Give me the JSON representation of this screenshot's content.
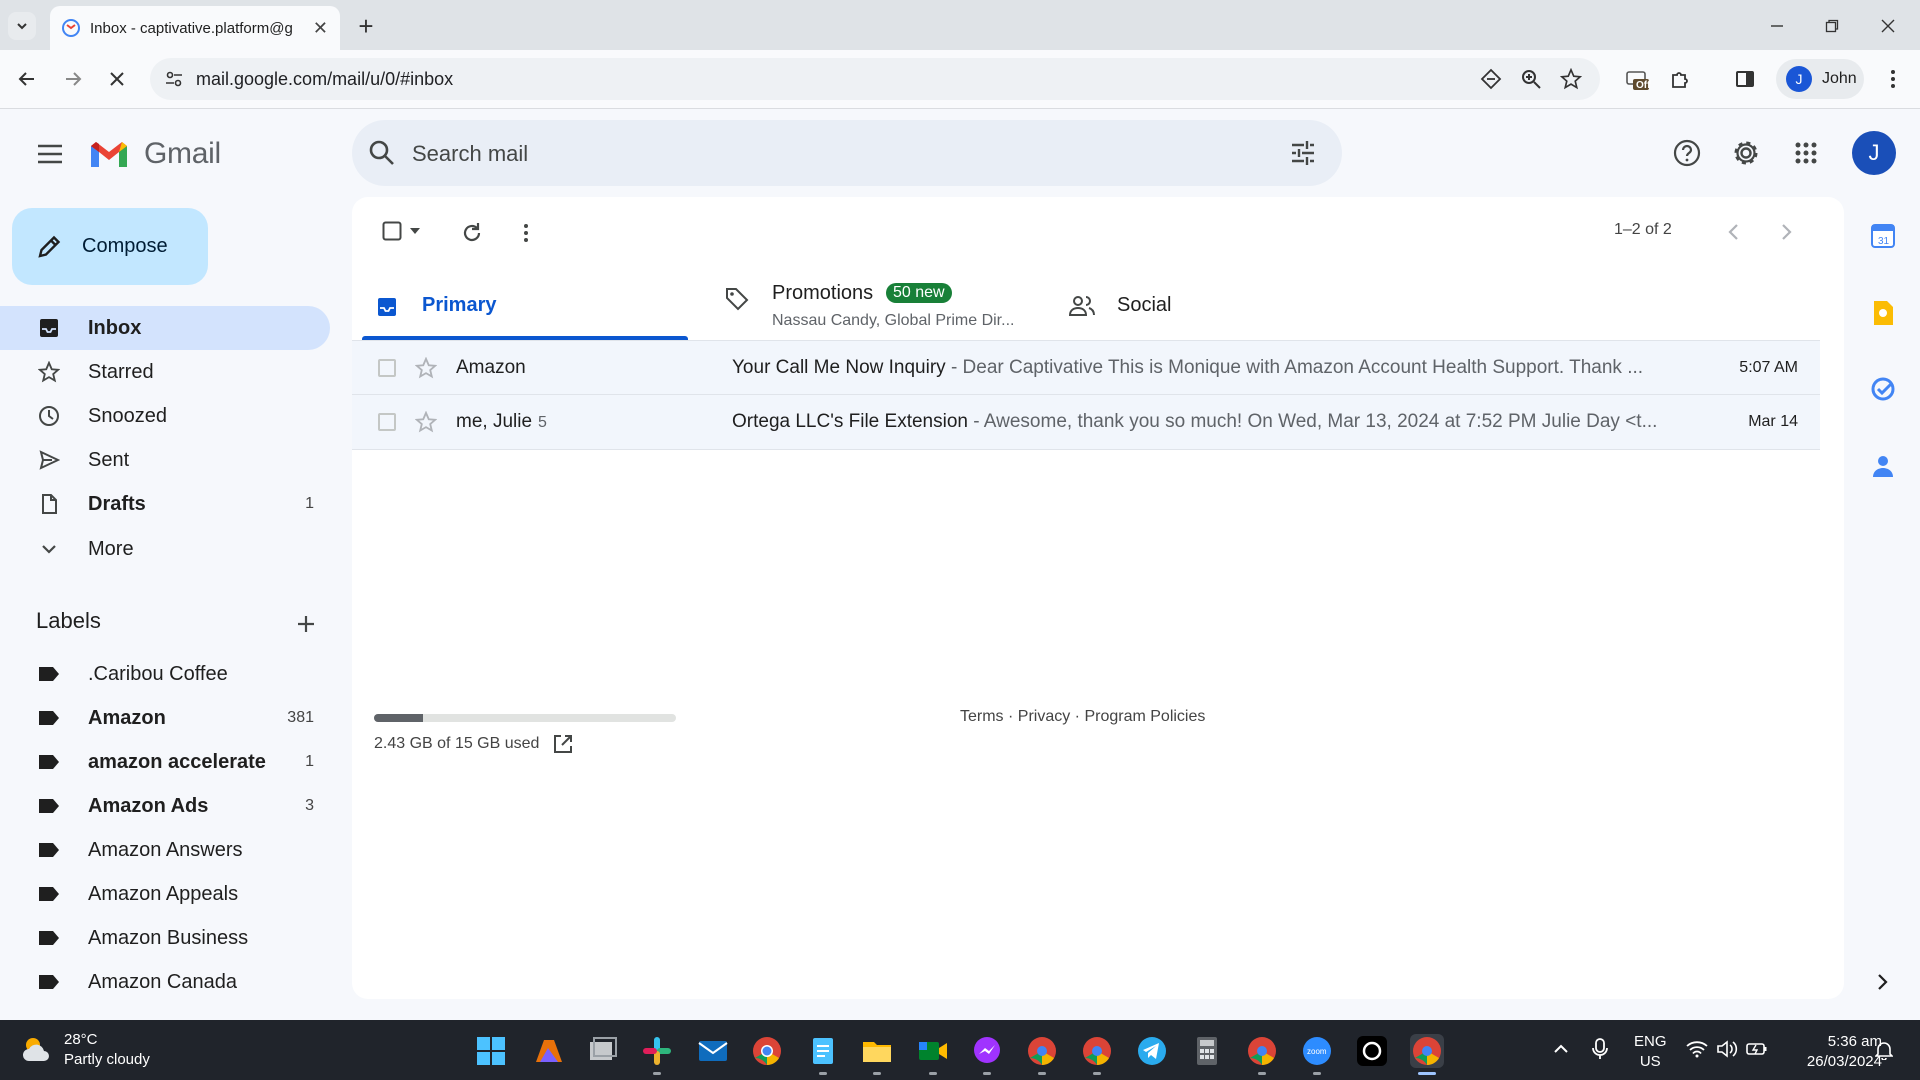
{
  "browser": {
    "tab_title": "Inbox - captivative.platform@g",
    "url": "mail.google.com/mail/u/0/#inbox",
    "profile_initial": "J",
    "profile_name": "John",
    "extension_badge": "Off"
  },
  "header": {
    "app_name": "Gmail",
    "search_placeholder": "Search mail",
    "account_initial": "J"
  },
  "compose": {
    "label": "Compose"
  },
  "nav": [
    {
      "label": "Inbox",
      "count": "",
      "icon": "inbox-icon"
    },
    {
      "label": "Starred",
      "count": "",
      "icon": "star-icon"
    },
    {
      "label": "Snoozed",
      "count": "",
      "icon": "clock-icon"
    },
    {
      "label": "Sent",
      "count": "",
      "icon": "send-icon"
    },
    {
      "label": "Drafts",
      "count": "1",
      "icon": "draft-icon"
    },
    {
      "label": "More",
      "count": "",
      "icon": "chevron-down-icon"
    }
  ],
  "labels": {
    "heading": "Labels",
    "items": [
      {
        "label": ".Caribou Coffee",
        "count": ""
      },
      {
        "label": "Amazon",
        "count": "381"
      },
      {
        "label": "amazon accelerate",
        "count": "1"
      },
      {
        "label": "Amazon Ads",
        "count": "3"
      },
      {
        "label": "Amazon Answers",
        "count": ""
      },
      {
        "label": "Amazon Appeals",
        "count": ""
      },
      {
        "label": "Amazon Business",
        "count": ""
      },
      {
        "label": "Amazon Canada",
        "count": ""
      }
    ]
  },
  "toolbar": {
    "pager": "1–2 of 2"
  },
  "tabs": {
    "primary": "Primary",
    "promotions": "Promotions",
    "promotions_badge": "50 new",
    "promotions_sub": "Nassau Candy, Global Prime Dir...",
    "social": "Social"
  },
  "emails": [
    {
      "sender": "Amazon",
      "count": "",
      "subject": "Your Call Me Now Inquiry",
      "snippet": " - Dear Captivative This is Monique with Amazon Account Health Support. Thank ...",
      "date": "5:07 AM"
    },
    {
      "sender": "me, Julie",
      "count": "5",
      "subject": "Ortega LLC's File Extension",
      "snippet": " - Awesome, thank you so much! On Wed, Mar 13, 2024 at 7:52 PM Julie Day <t...",
      "date": "Mar 14"
    }
  ],
  "storage": {
    "text": "2.43 GB of 15 GB used",
    "fraction": 0.162
  },
  "footer": {
    "terms": "Terms",
    "privacy": "Privacy",
    "policies": "Program Policies",
    "sep": " · "
  },
  "taskbar": {
    "temp": "28°C",
    "condition": "Partly cloudy",
    "lang1": "ENG",
    "lang2": "US",
    "time": "5:36 am",
    "date": "26/03/2024"
  },
  "colors": {
    "accent": "#0b57d0",
    "compose_bg": "#c2e7ff",
    "active_nav": "#d3e3fd",
    "badge_green": "#188038"
  }
}
